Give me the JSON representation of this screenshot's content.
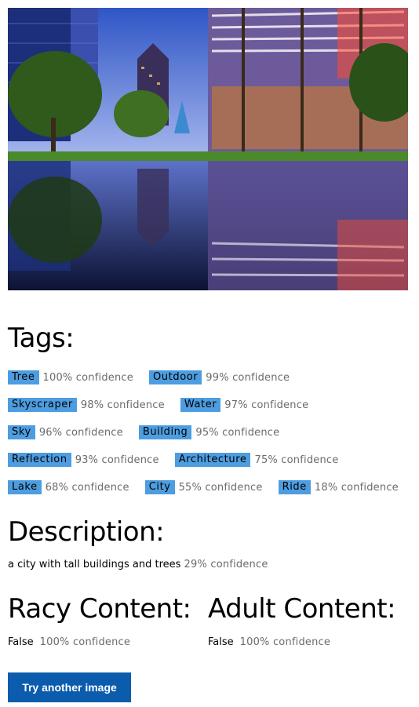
{
  "image": {
    "colors": {
      "sky_top": "#2f56c6",
      "sky_bottom": "#a9b8ee",
      "water": "#0d1233",
      "foliage": "#2f5a1c",
      "grass": "#4a8a2a",
      "canopy_lights": "#ff4b2b"
    }
  },
  "tags_title": "Tags:",
  "tag_rows": [
    [
      {
        "label": "Tree",
        "confidence": "100% confidence"
      },
      {
        "label": "Outdoor",
        "confidence": "99% confidence"
      }
    ],
    [
      {
        "label": "Skyscraper",
        "confidence": "98% confidence"
      },
      {
        "label": "Water",
        "confidence": "97% confidence"
      }
    ],
    [
      {
        "label": "Sky",
        "confidence": "96% confidence"
      },
      {
        "label": "Building",
        "confidence": "95% confidence"
      }
    ],
    [
      {
        "label": "Reflection",
        "confidence": "93% confidence"
      },
      {
        "label": "Architecture",
        "confidence": "75% confidence"
      }
    ],
    [
      {
        "label": "Lake",
        "confidence": "68% confidence"
      },
      {
        "label": "City",
        "confidence": "55% confidence"
      },
      {
        "label": "Ride",
        "confidence": "18% confidence"
      }
    ]
  ],
  "description": {
    "title": "Description:",
    "text": "a city with tall buildings and trees",
    "confidence": "29% confidence"
  },
  "racy": {
    "title": "Racy Content:",
    "value": "False",
    "confidence": "100% confidence"
  },
  "adult": {
    "title": "Adult Content:",
    "value": "False",
    "confidence": "100% confidence"
  },
  "actions": {
    "try_another": "Try another image"
  },
  "accent_color": "#4d9de0",
  "button_color": "#0b5cad"
}
